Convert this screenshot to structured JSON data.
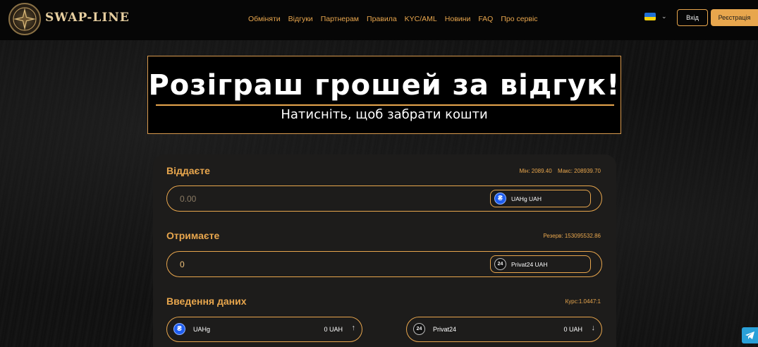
{
  "header": {
    "logo_text": "SWAP-LINE",
    "nav": [
      "Обміняти",
      "Відгуки",
      "Партнерам",
      "Правила",
      "KYC/AML",
      "Новини",
      "FAQ",
      "Про сервіс"
    ],
    "login_label": "Вхід",
    "register_label": "Реєстрація",
    "lang_chevron": "⌄"
  },
  "banner": {
    "title": "Розіграш грошей за відгук!",
    "subtitle": "Натисніть, щоб забрати кошти"
  },
  "give": {
    "title": "Віддаєте",
    "min": "Мін: 2089.40",
    "max": "Макс: 208939.70",
    "placeholder": "0.00",
    "currency": "UAHg UAH"
  },
  "receive": {
    "title": "Отримаєте",
    "reserve": "Резерв: 153095532.86",
    "value": "0",
    "currency": "Privat24 UAH"
  },
  "data_entry": {
    "title": "Введення даних",
    "rate": "Курс:1.0447:1",
    "from": {
      "name": "UAHg",
      "amount": "0 UAH",
      "arrow": "↑"
    },
    "to": {
      "name": "Privat24",
      "amount": "0 UAH",
      "arrow": "↓"
    }
  },
  "icons": {
    "uah_icon": "₴",
    "privat_icon": "24"
  },
  "colors": {
    "accent": "#e8a64d",
    "background": "#0d0d0d",
    "panel": "#1d1c1b",
    "telegram": "#2aa0d8"
  }
}
